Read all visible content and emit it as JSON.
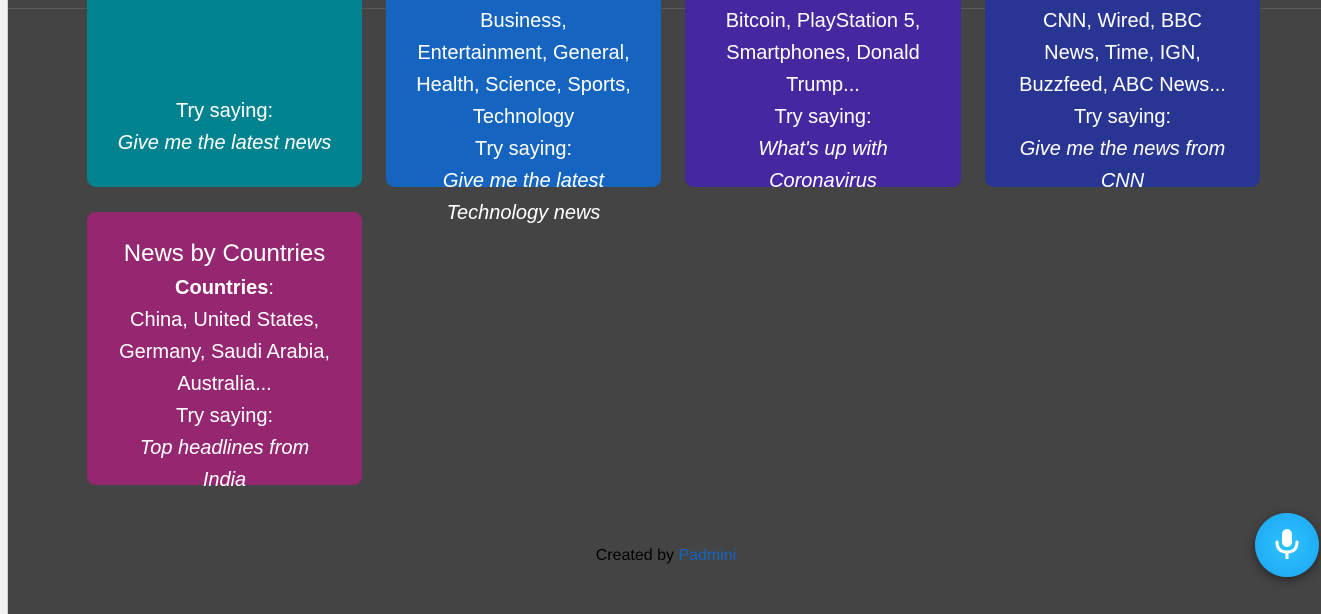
{
  "cards": [
    {
      "id": "general",
      "try_label": "Try saying:",
      "example": "Give me the latest news"
    },
    {
      "id": "category",
      "items": [
        "Business,",
        "Entertainment, General,",
        "Health, Science, Sports,",
        "Technology"
      ],
      "try_label": "Try saying:",
      "example_lines": [
        "Give me the latest",
        "Technology news"
      ]
    },
    {
      "id": "terms",
      "items": [
        "Bitcoin, PlayStation 5,",
        "Smartphones, Donald",
        "Trump..."
      ],
      "try_label": "Try saying:",
      "example_lines": [
        "What's up with",
        "Coronavirus"
      ]
    },
    {
      "id": "sources",
      "items": [
        "CNN, Wired, BBC",
        "News, Time, IGN,",
        "Buzzfeed, ABC News..."
      ],
      "try_label": "Try saying:",
      "example_lines": [
        "Give me the news from",
        "CNN"
      ]
    },
    {
      "id": "countries",
      "title": "News by Countries",
      "field_label": "Countries",
      "field_suffix": ":",
      "items": [
        "China, United States,",
        "Germany, Saudi Arabia,",
        "Australia..."
      ],
      "try_label": "Try saying:",
      "example_lines": [
        "Top headlines from",
        "India"
      ]
    }
  ],
  "footer": {
    "prefix": "Created by ",
    "author": "Padmini"
  },
  "colors": {
    "background": "#444444",
    "general": "#00838f",
    "category": "#1565c0",
    "terms": "#4527a0",
    "sources": "#283593",
    "countries": "#952670",
    "mic": "#1aa3f0"
  },
  "icons": {
    "mic_button": "microphone-icon"
  }
}
